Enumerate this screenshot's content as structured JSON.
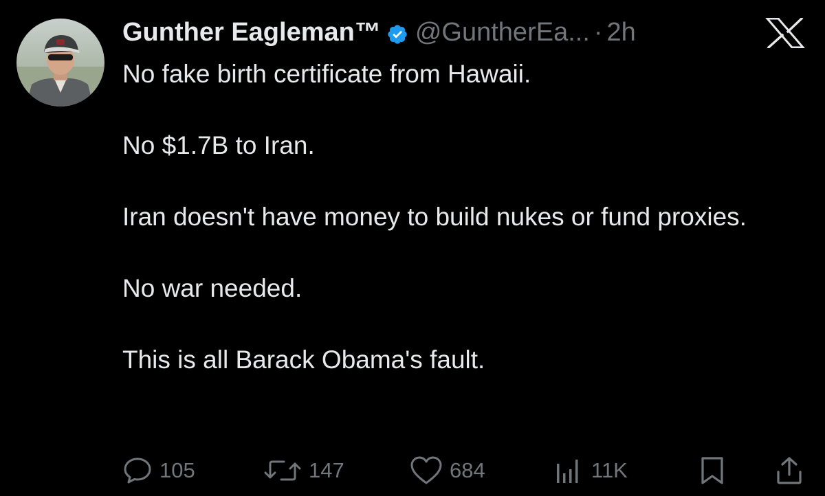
{
  "tweet": {
    "author": {
      "display_name": "Gunther Eagleman™",
      "handle": "@GuntherEa...",
      "separator": "·",
      "time": "2h",
      "verified": true,
      "avatar_icon": "profile-photo-avatar"
    },
    "platform_logo": "x-logo-icon",
    "body": [
      "No fake birth certificate from Hawaii.",
      "No $1.7B to Iran.",
      "Iran doesn't have money to build nukes or fund proxies.",
      "No war needed.",
      "This is all Barack Obama's fault."
    ],
    "actions": {
      "replies": "105",
      "reposts": "147",
      "likes": "684",
      "views": "11K"
    }
  },
  "colors": {
    "background": "#000000",
    "text_primary": "#e7e9ea",
    "text_secondary": "#71767b",
    "verified_blue": "#1d9bf0"
  }
}
